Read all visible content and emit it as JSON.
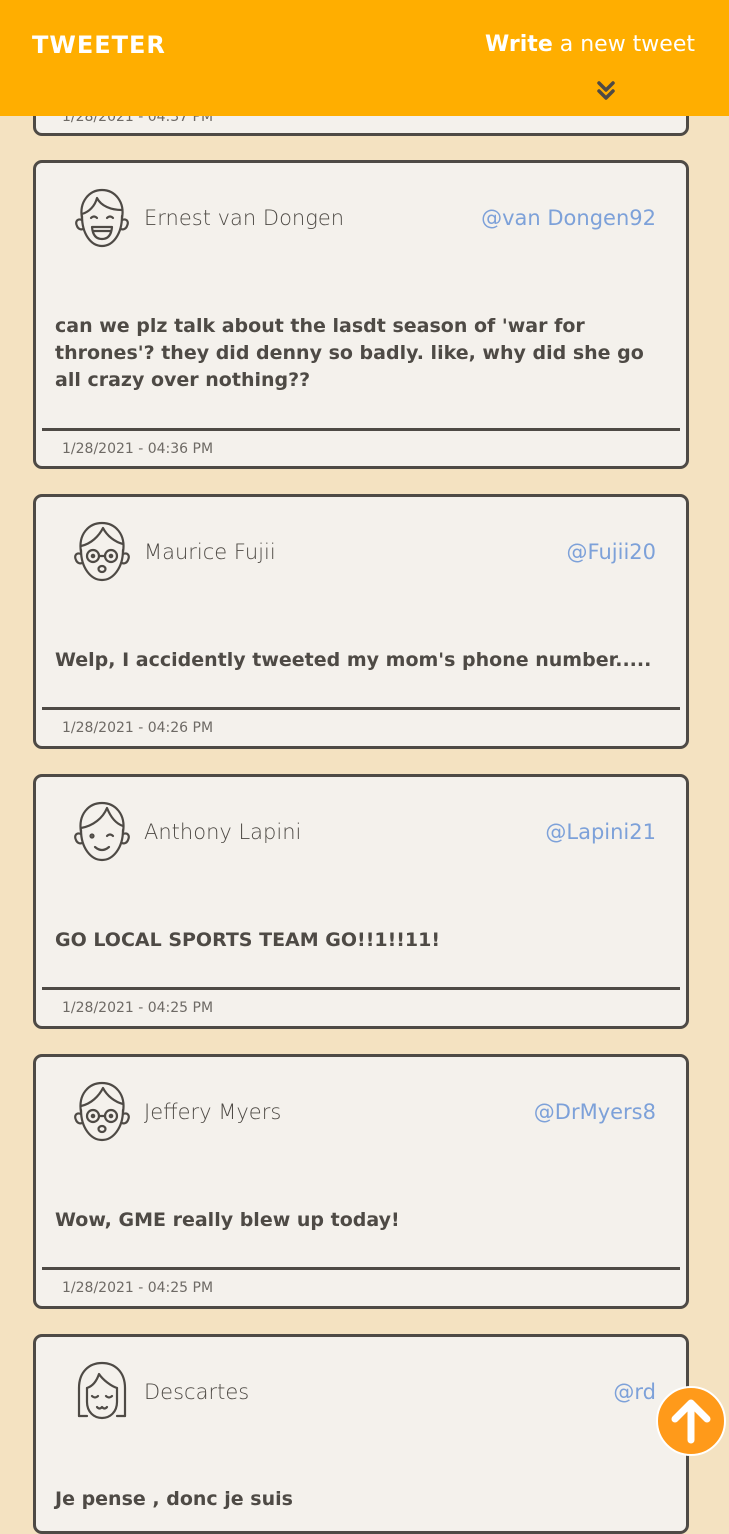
{
  "header": {
    "brand": "TWEETER",
    "write_bold": "Write",
    "write_rest": " a new tweet"
  },
  "first_partial": {
    "time": "1/28/2021 - 04:37 PM"
  },
  "tweets": [
    {
      "name": "Ernest van Dongen",
      "handle": "@van Dongen92",
      "text": "can we plz talk about the lasdt season of 'war for thrones'? they did denny so badly. like, why did she go all crazy over nothing??",
      "time": "1/28/2021 - 04:36 PM",
      "avatar": "laughing-boy"
    },
    {
      "name": "Maurice Fujii",
      "handle": "@Fujii20",
      "text": "Welp, I accidently tweeted my mom's phone number.....",
      "time": "1/28/2021 - 04:26 PM",
      "avatar": "glasses-face"
    },
    {
      "name": "Anthony Lapini",
      "handle": "@Lapini21",
      "text": "GO LOCAL SPORTS TEAM GO!!1!!11!",
      "time": "1/28/2021 - 04:25 PM",
      "avatar": "smiling-boy"
    },
    {
      "name": "Jeffery Myers",
      "handle": "@DrMyers8",
      "text": "Wow, GME really blew up today!",
      "time": "1/28/2021 - 04:25 PM",
      "avatar": "glasses-face"
    },
    {
      "name": "Descartes",
      "handle": "@rd",
      "text": "Je pense , donc je suis",
      "time": "",
      "avatar": "girl-bangs"
    }
  ],
  "colors": {
    "header_bg": "#ffae00",
    "page_bg": "#f4e2c1",
    "card_bg": "#f4f1ec",
    "ink": "#4e4a45",
    "handle": "#7da1d9",
    "scroll_up": "#ff9a1a"
  }
}
